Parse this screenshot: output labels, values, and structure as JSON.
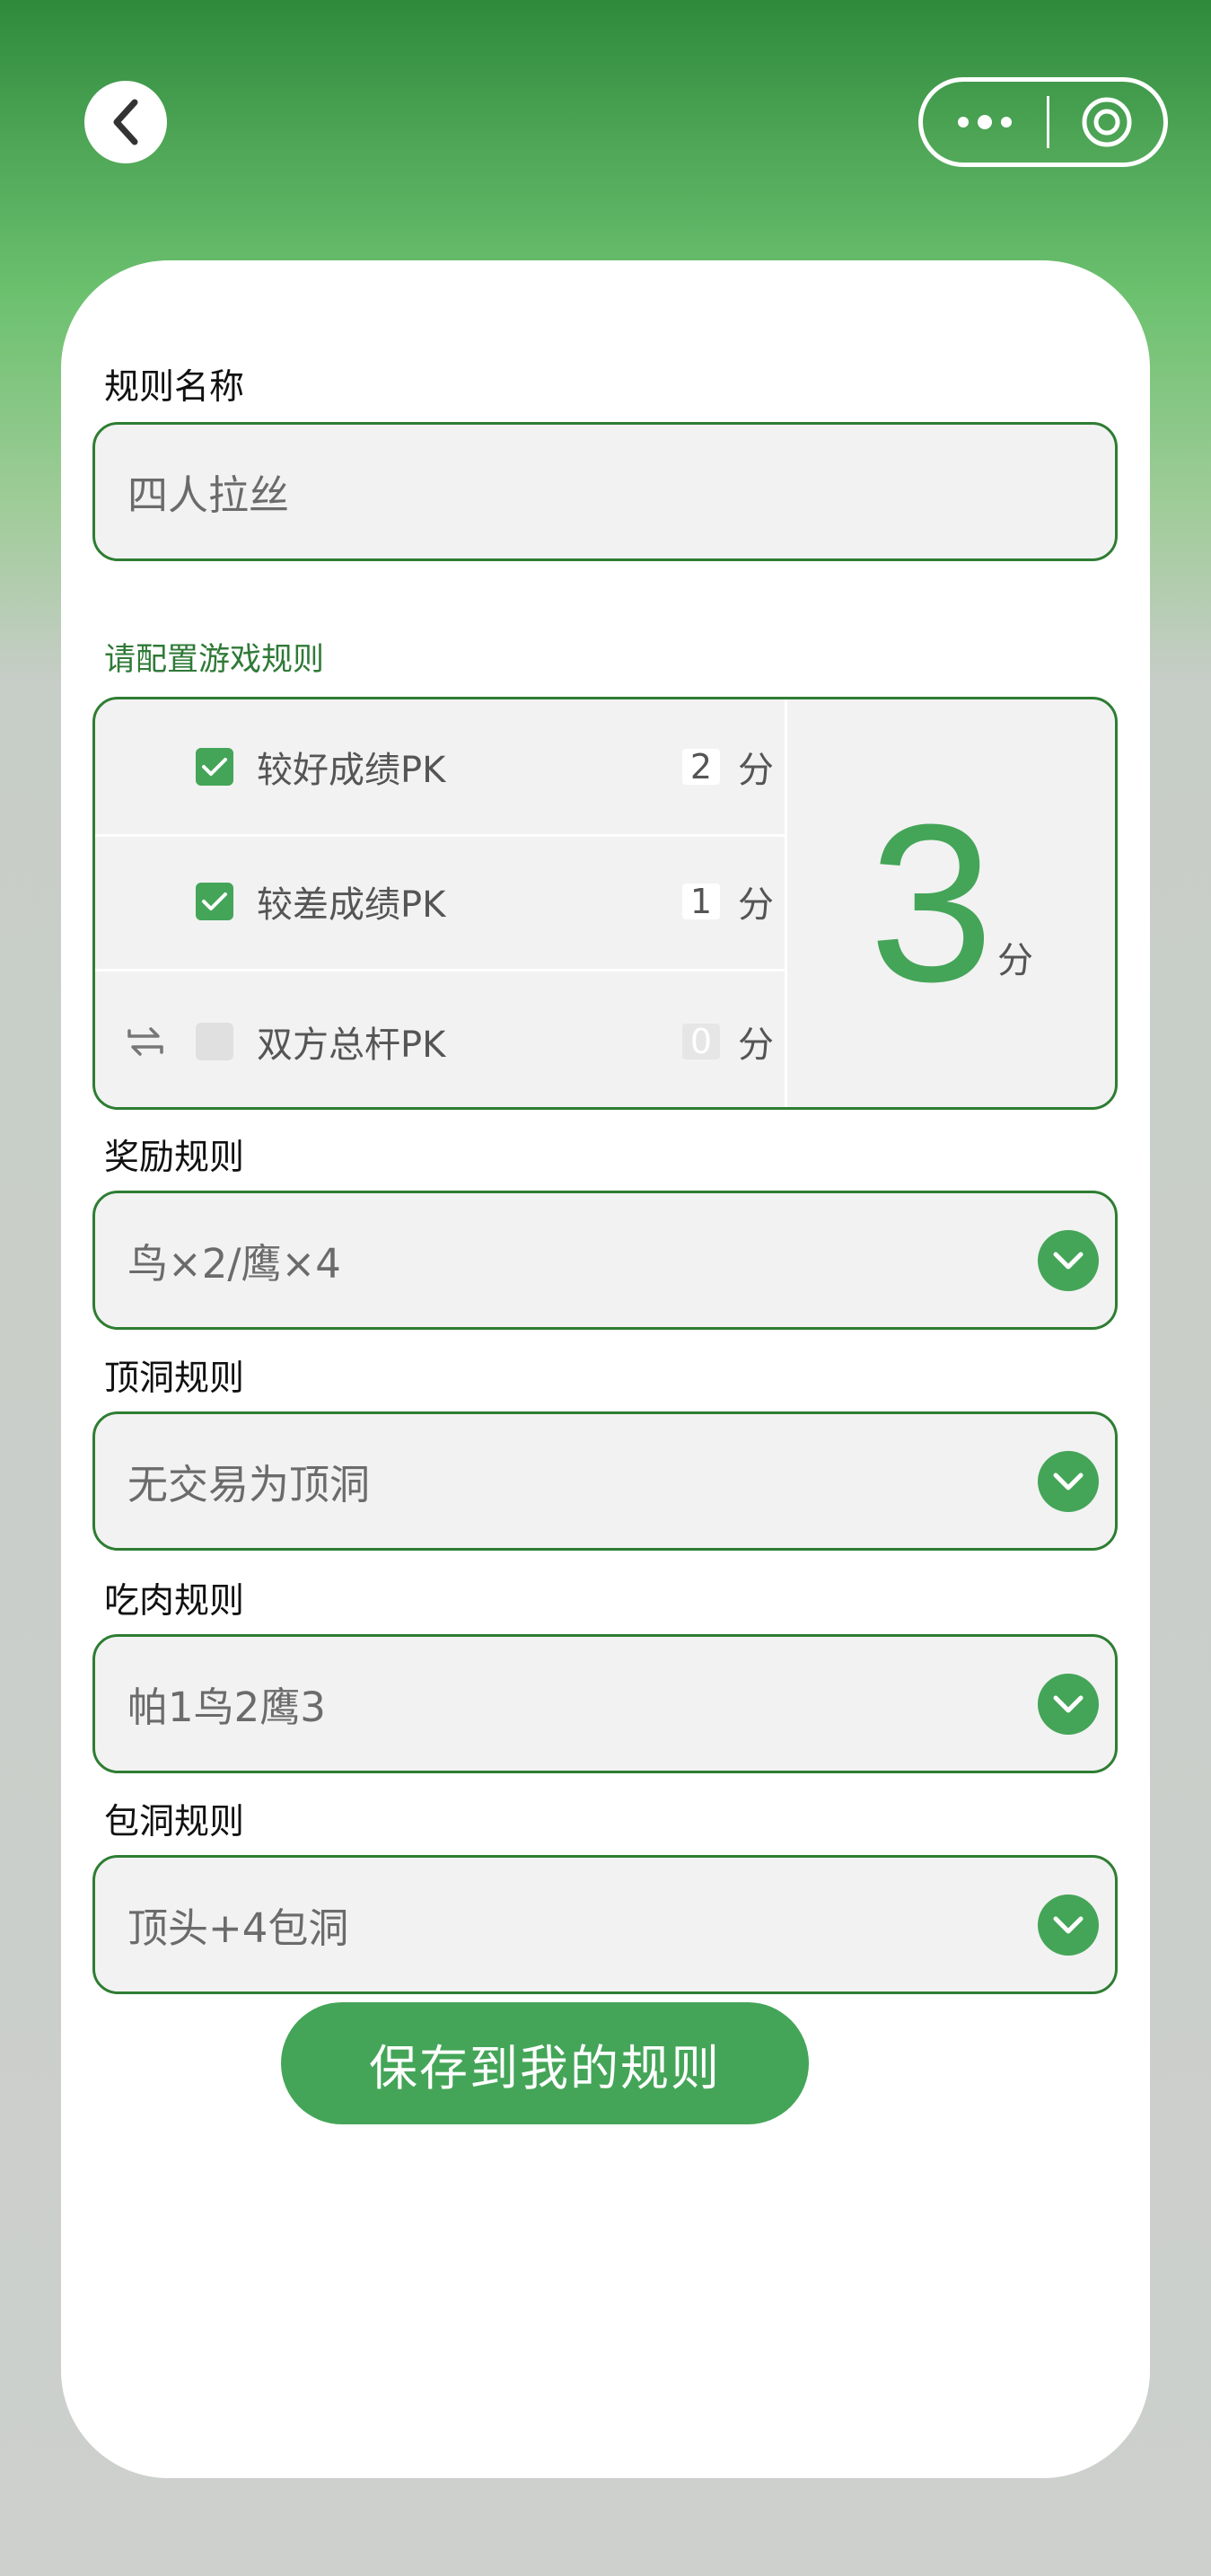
{
  "nav": {
    "back_icon": "chevron-left-icon",
    "more_icon": "more-dots-icon",
    "target_icon": "target-icon"
  },
  "form": {
    "name_label": "规则名称",
    "name_value": "四人拉丝",
    "config_label": "请配置游戏规则",
    "rules": [
      {
        "name": "较好成绩PK",
        "points": "2",
        "unit": "分",
        "checked": true
      },
      {
        "name": "较差成绩PK",
        "points": "1",
        "unit": "分",
        "checked": true
      },
      {
        "name": "双方总杆PK",
        "points": "0",
        "unit": "分",
        "checked": false
      }
    ],
    "total_points": "3",
    "total_unit": "分",
    "reward_label": "奖励规则",
    "reward_value": "鸟×2/鹰×4",
    "top_hole_label": "顶洞规则",
    "top_hole_value": "无交易为顶洞",
    "eat_label": "吃肉规则",
    "eat_value": "帕1鸟2鹰3",
    "bao_label": "包洞规则",
    "bao_value": "顶头+4包洞",
    "save_label": "保存到我的规则"
  },
  "colors": {
    "accent": "#44a558",
    "border": "#2e7d32"
  }
}
